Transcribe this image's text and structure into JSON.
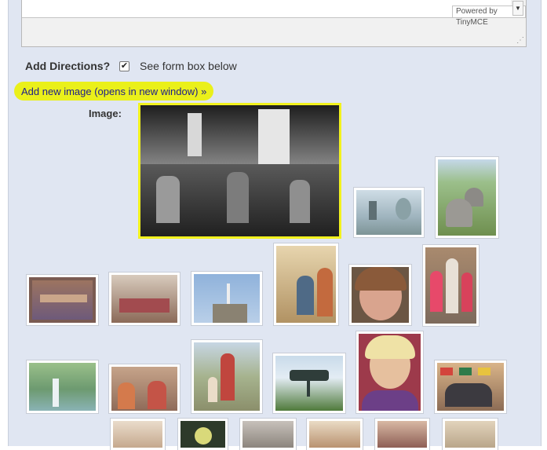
{
  "editor": {
    "powered_by": "Powered by TinyMCE",
    "scroll_down_icon": "▼",
    "resize_icon": "⋰"
  },
  "form": {
    "directions_label": "Add Directions?",
    "directions_checked": true,
    "checkbox_mark": "✔",
    "directions_note": "See form box below",
    "add_image_link": "Add new image (opens in new window) »",
    "image_label": "Image:"
  },
  "colors": {
    "panel_bg": "#e0e6f2",
    "highlight": "#eaf01a",
    "link": "#1c1c8c"
  }
}
